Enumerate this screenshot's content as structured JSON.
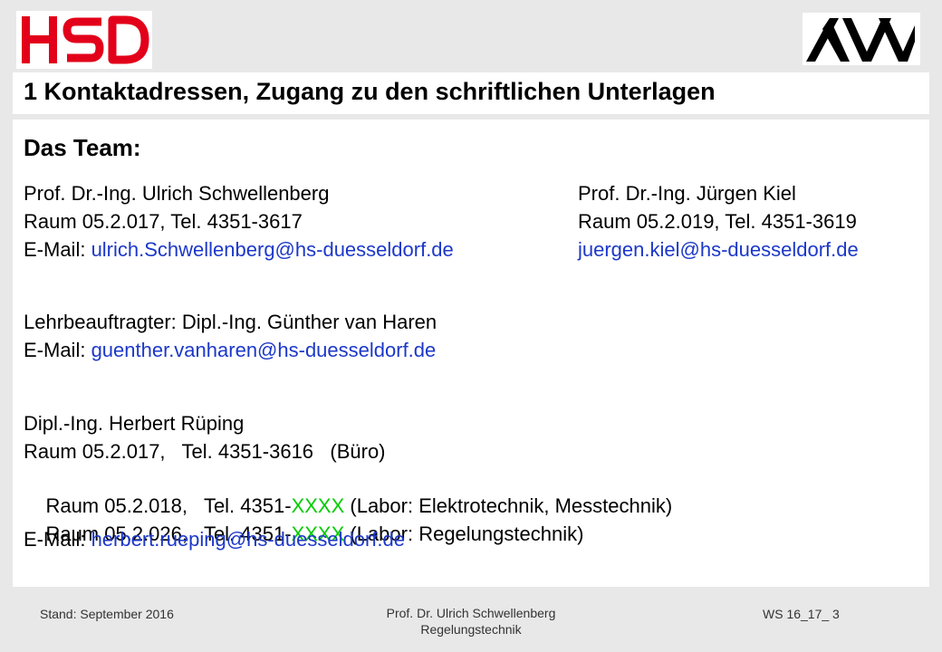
{
  "header": {
    "logo_left": "HSD",
    "logo_right": "MV",
    "brand_red": "#e2001a",
    "title": "1 Kontaktadressen, Zugang zu den schriftlichen Unterlagen"
  },
  "main": {
    "heading": "Das Team:",
    "person1": {
      "name": "Prof. Dr.-Ing. Ulrich Schwellenberg",
      "room": "Raum 05.2.017, Tel. 4351-3617",
      "email_label": "E-Mail: ",
      "email": "ulrich.Schwellenberg@hs-duesseldorf.de"
    },
    "person2": {
      "name": "Prof. Dr.-Ing. Jürgen Kiel",
      "room": "Raum 05.2.019, Tel. 4351-3619",
      "email": "juergen.kiel@hs-duesseldorf.de"
    },
    "lecturer": {
      "line": "Lehrbeauftragter: Dipl.-Ing. Günther van Haren",
      "email_label": "E-Mail: ",
      "email": "guenther.vanharen@hs-duesseldorf.de"
    },
    "person3": {
      "name": "Dipl.-Ing. Herbert Rüping",
      "room1": "Raum 05.2.017,   Tel. 4351-3616   (Büro)",
      "room2_pre": "Raum 05.2.018,   Tel. 4351-",
      "room2_x": "XXXX",
      "room2_post": " (Labor: Elektrotechnik, Messtechnik)",
      "room3_pre": "Raum 05.2.026,   Tel. 4351-",
      "room3_x": "XXXX",
      "room3_post": " (Labor: Regelungstechnik)",
      "email_label": "E-Mail: ",
      "email": "herbert.rueping@hs-duesseldorf.de"
    }
  },
  "footer": {
    "left": "Stand: September 2016",
    "center_line1": "Prof. Dr. Ulrich Schwellenberg",
    "center_line2": "Regelungstechnik",
    "right": "WS 16_17_ 3"
  }
}
